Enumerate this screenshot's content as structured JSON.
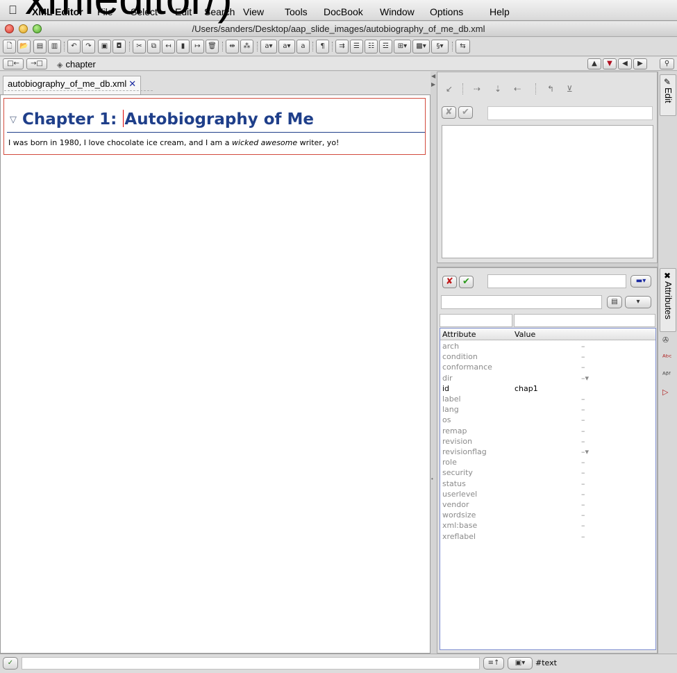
{
  "overlay_text": "xmleditor/)",
  "menubar": {
    "apple_icon": "apple-icon",
    "items": [
      {
        "label": "XML Editor",
        "bold": true
      },
      {
        "label": "File"
      },
      {
        "label": "Select"
      },
      {
        "label": "Edit"
      },
      {
        "label": "Search"
      },
      {
        "label": "View"
      },
      {
        "label": "Tools"
      },
      {
        "label": "DocBook"
      },
      {
        "label": "Window"
      },
      {
        "label": "Options"
      },
      {
        "label": "Help"
      }
    ]
  },
  "window": {
    "title": "/Users/sanders/Desktop/aap_slide_images/autobiography_of_me_db.xml"
  },
  "toolbar": {
    "buttons": [
      {
        "name": "new-document-icon",
        "glyph": "🗋"
      },
      {
        "name": "open-document-icon",
        "glyph": "📂"
      },
      {
        "name": "save-icon",
        "glyph": "▤"
      },
      {
        "name": "save-all-icon",
        "glyph": "▥"
      },
      {
        "name": "undo-icon",
        "glyph": "↶"
      },
      {
        "name": "redo-icon",
        "glyph": "↷"
      },
      {
        "name": "validate-icon",
        "glyph": "▣"
      },
      {
        "name": "check-icon",
        "glyph": "◘"
      },
      {
        "name": "cut-icon",
        "glyph": "✂"
      },
      {
        "name": "copy-icon",
        "glyph": "⧉"
      },
      {
        "name": "paste-before-icon",
        "glyph": "↤"
      },
      {
        "name": "paste-icon",
        "glyph": "▮"
      },
      {
        "name": "paste-after-icon",
        "glyph": "↦"
      },
      {
        "name": "delete-icon",
        "glyph": "🗑"
      },
      {
        "name": "join-icon",
        "glyph": "⇹"
      },
      {
        "name": "split-icon",
        "glyph": "⁂"
      },
      {
        "name": "emphasis-icon",
        "glyph": "a▾"
      },
      {
        "name": "link-icon",
        "glyph": "a▾"
      },
      {
        "name": "convert-icon",
        "glyph": "a"
      },
      {
        "name": "paragraph-icon",
        "glyph": "¶"
      },
      {
        "name": "indent-icon",
        "glyph": "⇉"
      },
      {
        "name": "bullet-list-icon",
        "glyph": "☰"
      },
      {
        "name": "numbered-list-icon",
        "glyph": "☷"
      },
      {
        "name": "definition-list-icon",
        "glyph": "☲"
      },
      {
        "name": "table-icon",
        "glyph": "⊞▾"
      },
      {
        "name": "image-icon",
        "glyph": "▩▾"
      },
      {
        "name": "section-icon",
        "glyph": "§▾"
      },
      {
        "name": "link-to-icon",
        "glyph": "⇆"
      }
    ]
  },
  "breadcrumb": {
    "element": "chapter",
    "nav_buttons": [
      "▲",
      "▼",
      "◀",
      "▶"
    ],
    "search_icon": "search-icon"
  },
  "editor": {
    "tab_label": "autobiography_of_me_db.xml",
    "tab_close": "✕",
    "chapter_prefix": "Chapter 1:",
    "chapter_title": "Autobiography of Me",
    "para_before": "I was born in 1980, I love chocolate ice cream, and I am a ",
    "para_emphasis": "wicked awesome",
    "para_after": " writer, yo!"
  },
  "edit_panel": {
    "tab_label": "Edit",
    "icons": [
      "↙",
      "⇢",
      "⇣",
      "⇠",
      "↰",
      "⊻"
    ]
  },
  "attributes_panel": {
    "tab_label": "Attributes",
    "column_attribute": "Attribute",
    "column_value": "Value",
    "rows": [
      {
        "name": "arch",
        "value": "",
        "dash": "–"
      },
      {
        "name": "condition",
        "value": "",
        "dash": "–"
      },
      {
        "name": "conformance",
        "value": "",
        "dash": "–"
      },
      {
        "name": "dir",
        "value": "",
        "dash": "–▾"
      },
      {
        "name": "id",
        "value": "chap1",
        "dash": ""
      },
      {
        "name": "label",
        "value": "",
        "dash": "–"
      },
      {
        "name": "lang",
        "value": "",
        "dash": "–"
      },
      {
        "name": "os",
        "value": "",
        "dash": "–"
      },
      {
        "name": "remap",
        "value": "",
        "dash": "–"
      },
      {
        "name": "revision",
        "value": "",
        "dash": "–"
      },
      {
        "name": "revisionflag",
        "value": "",
        "dash": "–▾"
      },
      {
        "name": "role",
        "value": "",
        "dash": "–"
      },
      {
        "name": "security",
        "value": "",
        "dash": "–"
      },
      {
        "name": "status",
        "value": "",
        "dash": "–"
      },
      {
        "name": "userlevel",
        "value": "",
        "dash": "–"
      },
      {
        "name": "vendor",
        "value": "",
        "dash": "–"
      },
      {
        "name": "wordsize",
        "value": "",
        "dash": "–"
      },
      {
        "name": "xml:base",
        "value": "",
        "dash": "–"
      },
      {
        "name": "xreflabel",
        "value": "",
        "dash": "–"
      }
    ]
  },
  "side_tools": [
    "✇",
    "ᴬᵇᶜ",
    "ᴬᵝᶠ",
    "▷"
  ],
  "statusbar": {
    "node": "#text"
  },
  "colors": {
    "chapter_title": "#1f3f8a",
    "selection_border": "#d24a3c",
    "attr_set": "#000000",
    "attr_unset": "#8a8a8a"
  }
}
